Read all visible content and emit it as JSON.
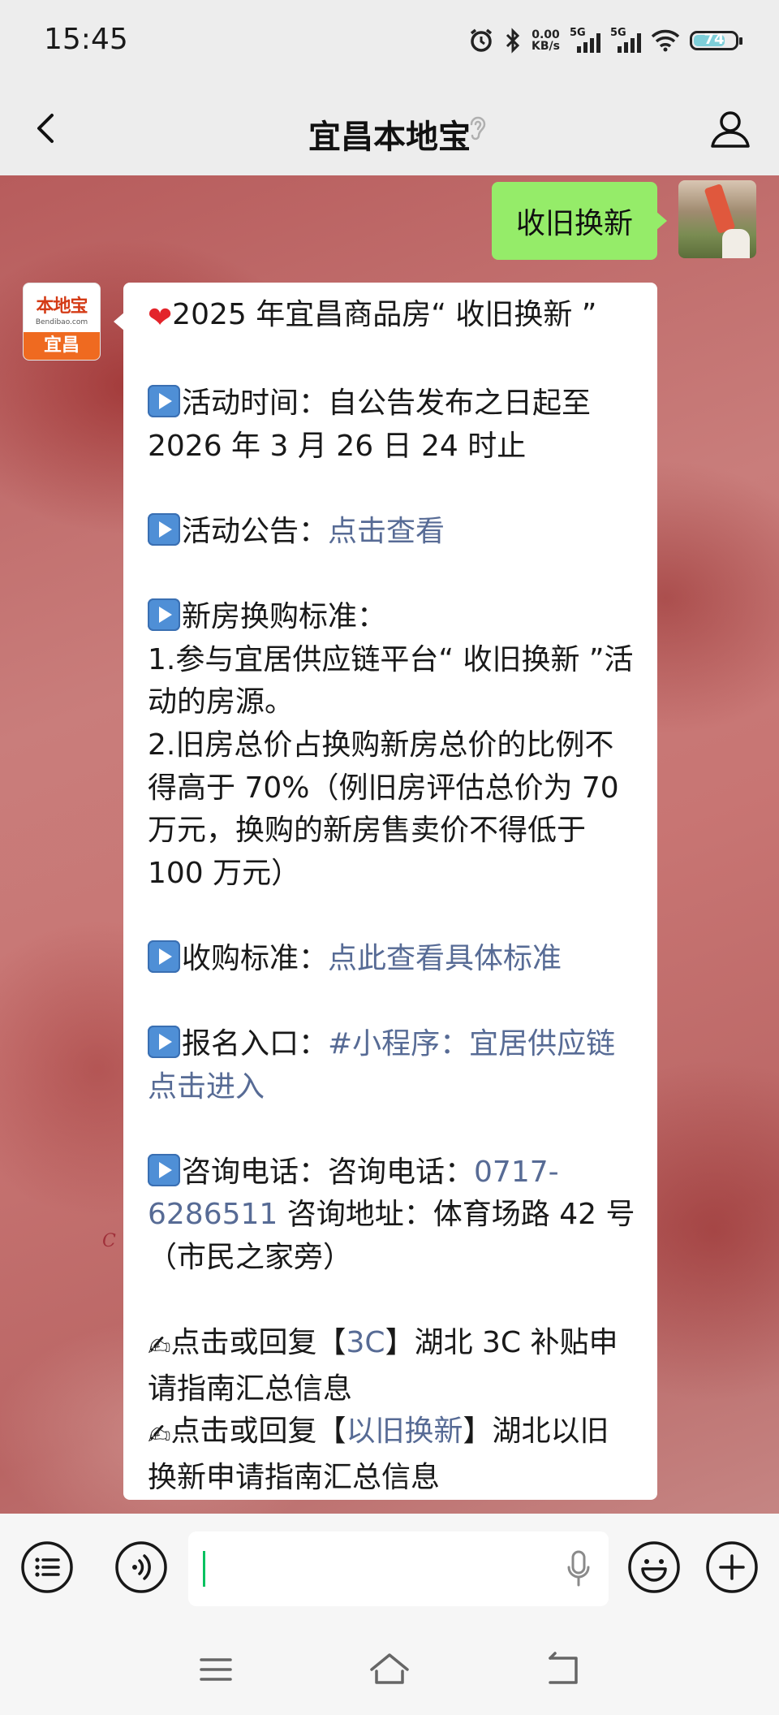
{
  "status_bar": {
    "time": "15:45",
    "net_speed_value": "0.00",
    "net_speed_unit": "KB/s",
    "sim1": "5G",
    "sim2": "5G",
    "battery": "74",
    "icons": [
      "alarm-icon",
      "bluetooth-icon",
      "signal-icon",
      "wifi-icon",
      "battery-icon"
    ]
  },
  "header": {
    "title": "宜昌本地宝",
    "back_icon": "chevron-left-icon",
    "ear_icon": "ear-icon",
    "profile_icon": "person-icon"
  },
  "chat": {
    "sent_message": "收旧换新",
    "bot_avatar": {
      "brand": "本地宝",
      "domain": "Bendibao.com",
      "city": "宜昌"
    },
    "reply": {
      "title": "2025 年宜昌商品房“ 收旧换新 ”",
      "time_label": "活动时间：",
      "time_value": "自公告发布之日起至 2026 年 3 月 26 日 24 时止",
      "notice_label": "活动公告：",
      "notice_link": "点击查看",
      "standard_label": "新房换购标准：",
      "standard_1": "1.参与宜居供应链平台“ 收旧换新 ”活动的房源。",
      "standard_2": "2.旧房总价占换购新房总价的比例不得高于 70%（例旧房评估总价为 70 万元，换购的新房售卖价不得低于 100 万元）",
      "purchase_label": "收购标准：",
      "purchase_link": "点此查看具体标准",
      "signup_label": "报名入口：",
      "signup_link": "#小程序：宜居供应链点击进入",
      "consult_label": "咨询电话：",
      "consult_prefix": "咨询电话：",
      "phone": "0717-6286511",
      "address": " 咨询地址：体育场路 42 号（市民之家旁）",
      "tip1_prefix": "点击或回复【",
      "tip1_link": "3C",
      "tip1_suffix": "】湖北 3C 补贴申请指南汇总信息",
      "tip2_prefix": "点击或回复【",
      "tip2_link": "以旧换新",
      "tip2_suffix": "】湖北以旧换新申请指南汇总信息"
    }
  },
  "input_bar": {
    "text_value": "",
    "left_icons": [
      "menu-list-icon",
      "voice-toggle-icon"
    ],
    "right_icons": [
      "emoji-icon",
      "plus-icon"
    ],
    "mic_icon": "microphone-icon"
  },
  "system_nav": [
    "menu-icon",
    "home-icon",
    "back-icon"
  ],
  "colors": {
    "sent_bubble": "#95ec69",
    "link": "#576b95",
    "background": "#ededed",
    "caret": "#07c160"
  }
}
